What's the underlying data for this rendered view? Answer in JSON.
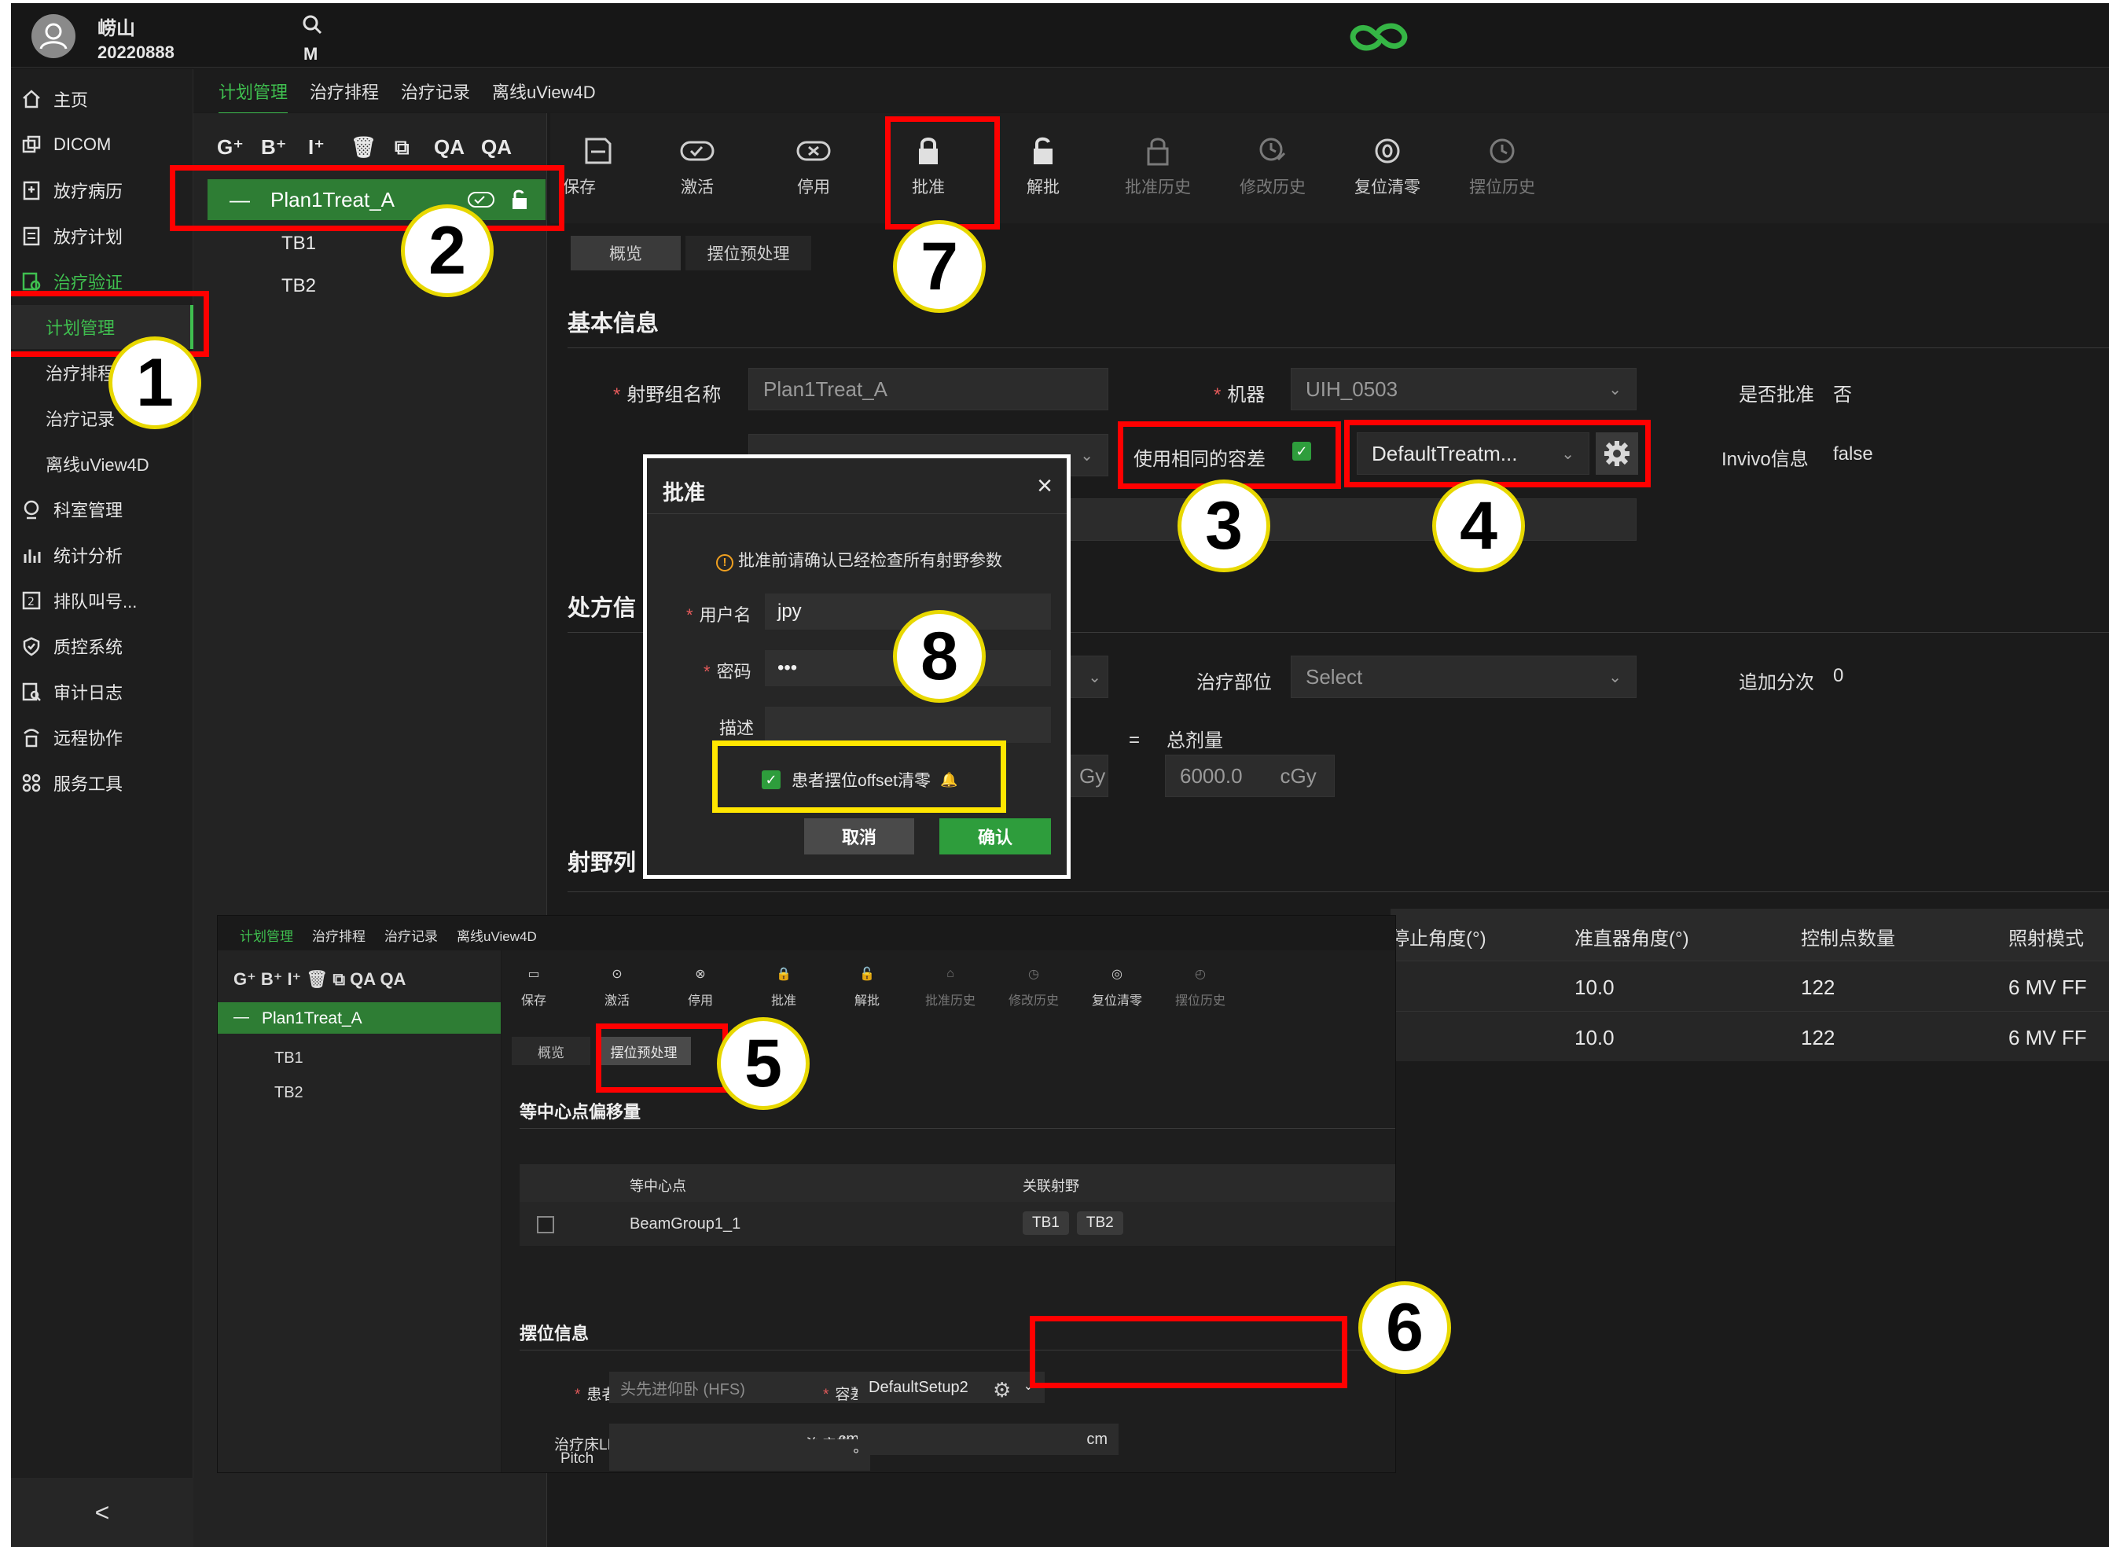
{
  "user": {
    "name": "崂山",
    "id": "20220888"
  },
  "header": {
    "search_key": "M"
  },
  "sidebar": {
    "items": [
      {
        "label": "主页",
        "icon": "home-icon"
      },
      {
        "label": "DICOM",
        "icon": "dicom-icon"
      },
      {
        "label": "放疗病历",
        "icon": "record-icon"
      },
      {
        "label": "放疗计划",
        "icon": "plan-icon"
      },
      {
        "label": "治疗验证",
        "icon": "verify-icon"
      }
    ],
    "subitems": [
      "计划管理",
      "治疗排程",
      "治疗记录",
      "离线uView4D"
    ],
    "items2": [
      {
        "label": "科室管理",
        "icon": "department-icon"
      },
      {
        "label": "统计分析",
        "icon": "chart-icon"
      },
      {
        "label": "排队叫号...",
        "icon": "queue-icon"
      },
      {
        "label": "质控系统",
        "icon": "shield-icon"
      },
      {
        "label": "审计日志",
        "icon": "audit-icon"
      },
      {
        "label": "远程协作",
        "icon": "remote-icon"
      },
      {
        "label": "服务工具",
        "icon": "tools-icon"
      }
    ],
    "collapse": "<"
  },
  "tabs": [
    "计划管理",
    "治疗排程",
    "治疗记录",
    "离线uView4D"
  ],
  "tree_tools": [
    "G⁺",
    "B⁺",
    "I⁺",
    "🗑",
    "⧉",
    "QA",
    "QA"
  ],
  "tree": {
    "selected": "Plan1Treat_A",
    "children": [
      "TB1",
      "TB2"
    ]
  },
  "toolbar": [
    "保存",
    "激活",
    "停用",
    "批准",
    "解批",
    "批准历史",
    "修改历史",
    "复位清零",
    "摆位历史"
  ],
  "subtabs": [
    "概览",
    "摆位预处理"
  ],
  "basic": {
    "title": "基本信息",
    "beam_group_label": "射野组名称",
    "beam_group_value": "Plan1Treat_A",
    "machine_label": "机器",
    "machine_value": "UIH_0503",
    "approved_label": "是否批准",
    "approved_value": "否",
    "same_tolerance_label": "使用相同的容差",
    "tolerance_value": "DefaultTreatm...",
    "invivo_label": "Invivo信息",
    "invivo_value": "false"
  },
  "prescription": {
    "title": "处方信",
    "site_label": "治疗部位",
    "site_placeholder": "Select",
    "add_fraction_label": "追加分次",
    "add_fraction_value": "0",
    "unit_gy": "Gy",
    "equals": "=",
    "total_label": "总剂量",
    "total_value": "6000.0",
    "total_unit": "cGy"
  },
  "beams": {
    "title": "射野列",
    "headers": [
      "停止角度(°)",
      "准直器角度(°)",
      "控制点数量",
      "照射模式"
    ],
    "rows": [
      [
        "10.0",
        "122",
        "6 MV FF"
      ],
      [
        "10.0",
        "122",
        "6 MV FF"
      ]
    ]
  },
  "dialog": {
    "title": "批准",
    "warning": "批准前请确认已经检查所有射野参数",
    "username_label": "用户名",
    "username_value": "jpy",
    "password_label": "密码",
    "password_value": "•••",
    "desc_label": "描述",
    "offset_label": "患者摆位offset清零",
    "cancel": "取消",
    "confirm": "确认"
  },
  "inset": {
    "tabs": [
      "计划管理",
      "治疗排程",
      "治疗记录",
      "离线uView4D"
    ],
    "tree_selected": "Plan1Treat_A",
    "tree_children": [
      "TB1",
      "TB2"
    ],
    "toolbar": [
      "保存",
      "激活",
      "停用",
      "批准",
      "解批",
      "批准历史",
      "修改历史",
      "复位清零",
      "摆位历史"
    ],
    "subtabs": [
      "概览",
      "摆位预处理"
    ],
    "iso_title": "等中心点偏移量",
    "iso_headers": [
      "等中心点",
      "关联射野"
    ],
    "iso_row": {
      "name": "BeamGroup1_1",
      "beams": [
        "TB1",
        "TB2"
      ]
    },
    "setup_title": "摆位信息",
    "posture_label": "患者体位",
    "posture_value": "头先进仰卧 (HFS)",
    "tolerance_label": "容差",
    "tolerance_value": "DefaultSetup2",
    "lng_label": "治疗床LNG",
    "vrt_label": "治疗床VRT",
    "unit_cm": "cm",
    "pitch_label": "Pitch",
    "pitch_unit": "°"
  },
  "badges": [
    "1",
    "2",
    "3",
    "4",
    "5",
    "6",
    "7",
    "8"
  ],
  "colors": {
    "accent": "#3fbf4f",
    "annotation_red": "#ff0000",
    "annotation_yellow": "#ffe600"
  }
}
